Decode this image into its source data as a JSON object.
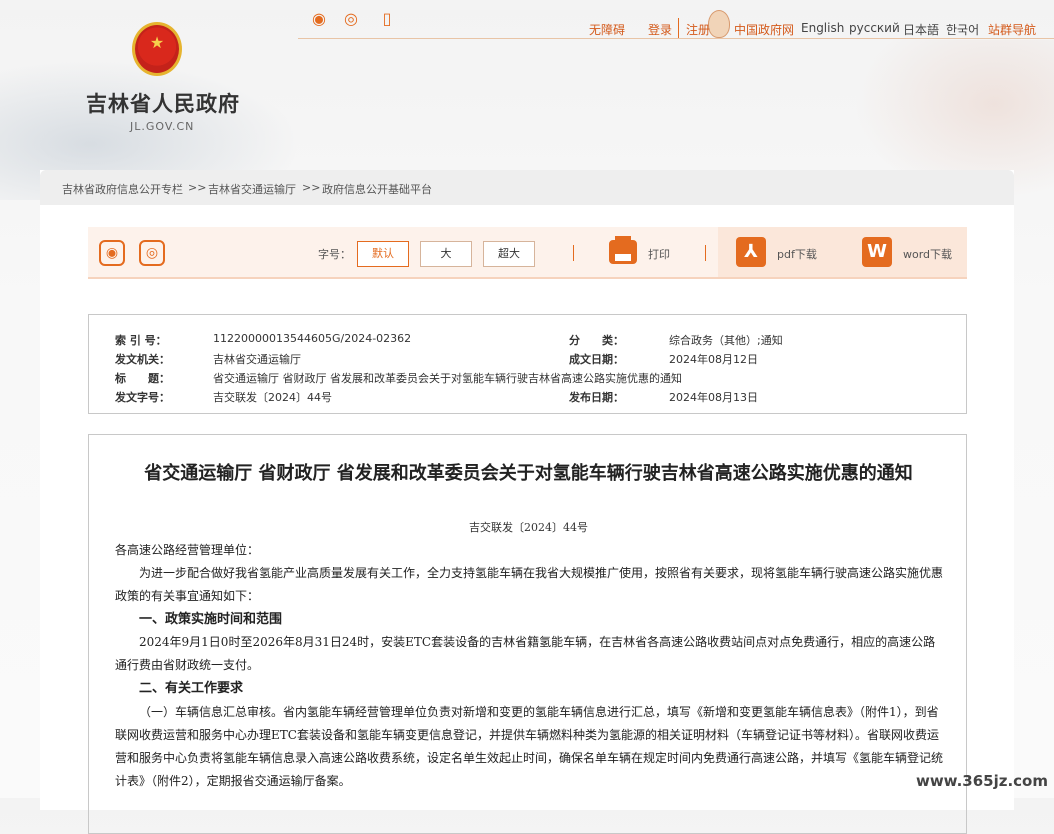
{
  "site": {
    "name": "吉林省人民政府",
    "domain": "JL.GOV.CN"
  },
  "topbar": {
    "accessibility": "无障碍",
    "login": "登录",
    "register": "注册",
    "gov_cn": "中国政府网",
    "english": "English",
    "russian": "русский",
    "japanese": "日本語",
    "korean": "한국어",
    "site_nav": "站群导航"
  },
  "breadcrumb": {
    "items": [
      "吉林省政府信息公开专栏",
      "吉林省交通运输厅",
      "政府信息公开基础平台"
    ],
    "separator": ">>"
  },
  "toolbar": {
    "font_size_label": "字号：",
    "size_default": "默认",
    "size_large": "大",
    "size_xlarge": "超大",
    "print": "打印",
    "pdf": "pdf下载",
    "word": "word下载"
  },
  "meta": {
    "index_no_label": "索 引 号：",
    "index_no": "11220000013544605G/2024-02362",
    "category_label": "分　　类：",
    "category": "综合政务（其他）;通知",
    "issuer_label": "发文机关：",
    "issuer": "吉林省交通运输厅",
    "created_label": "成文日期：",
    "created": "2024年08月12日",
    "title_label": "标　　题：",
    "title": "省交通运输厅 省财政厅 省发展和改革委员会关于对氢能车辆行驶吉林省高速公路实施优惠的通知",
    "doc_no_label": "发文字号：",
    "doc_no": "吉交联发〔2024〕44号",
    "published_label": "发布日期：",
    "published": "2024年08月13日"
  },
  "article": {
    "title": "省交通运输厅  省财政厅  省发展和改革委员会关于对氢能车辆行驶吉林省高速公路实施优惠的通知",
    "doc_no": "吉交联发〔2024〕44号",
    "salutation": "各高速公路经营管理单位：",
    "p1": "为进一步配合做好我省氢能产业高质量发展有关工作，全力支持氢能车辆在我省大规模推广使用，按照省有关要求，现将氢能车辆行驶高速公路实施优惠政策的有关事宜通知如下：",
    "h1": "一、政策实施时间和范围",
    "p2": "2024年9月1日0时至2026年8月31日24时，安装ETC套装设备的吉林省籍氢能车辆，在吉林省各高速公路收费站间点对点免费通行，相应的高速公路通行费由省财政统一支付。",
    "h2": "二、有关工作要求",
    "p3": "（一）车辆信息汇总审核。省内氢能车辆经营管理单位负责对新增和变更的氢能车辆信息进行汇总，填写《新增和变更氢能车辆信息表》（附件1），到省联网收费运营和服务中心办理ETC套装设备和氢能车辆变更信息登记，并提供车辆燃料种类为氢能源的相关证明材料（车辆登记证书等材料）。省联网收费运营和服务中心负责将氢能车辆信息录入高速公路收费系统，设定名单生效起止时间，确保名单车辆在规定时间内免费通行高速公路，并填写《氢能车辆登记统计表》（附件2），定期报省交通运输厅备案。"
  },
  "watermark": "www.365jz.com"
}
